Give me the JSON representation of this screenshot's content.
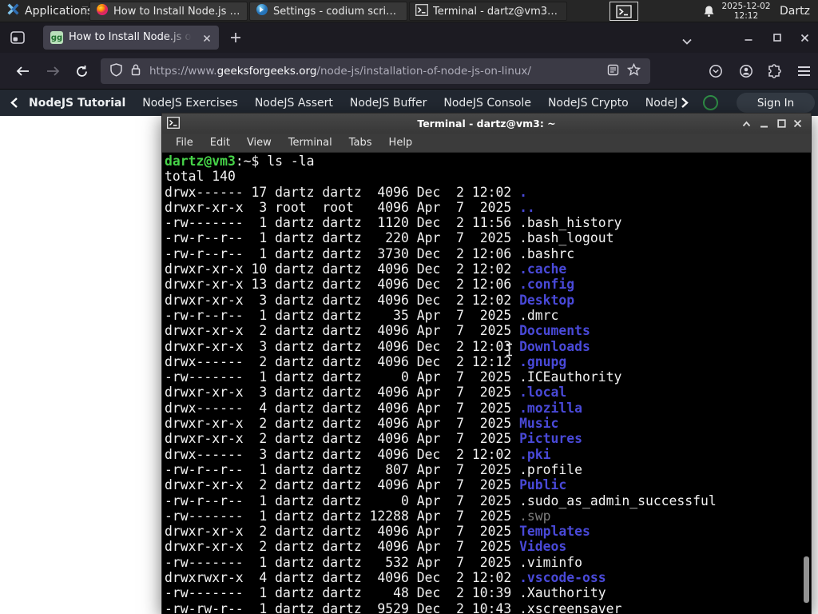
{
  "panel": {
    "applications_label": "Applications",
    "windows": [
      {
        "label": "How to Install Node.js o...",
        "icon": "firefox"
      },
      {
        "label": "Settings - codium script...",
        "icon": "vscodium"
      },
      {
        "label": "Terminal - dartz@vm3: ~",
        "icon": "terminal"
      }
    ],
    "clock_date": "2025-12-02",
    "clock_time": "12:12",
    "user_label": "Dartz"
  },
  "browser": {
    "tab_title": "How to Install Node.js on",
    "favicon_text": "gg",
    "url_prefix": "https://www.",
    "url_domain": "geeksforgeeks.org",
    "url_path": "/node-js/installation-of-node-js-on-linux/"
  },
  "site_nav": {
    "links": [
      "NodeJS Tutorial",
      "NodeJS Exercises",
      "NodeJS Assert",
      "NodeJS Buffer",
      "NodeJS Console",
      "NodeJS Crypto",
      "NodeJS DNS",
      "Node"
    ],
    "sign_in_label": "Sign In"
  },
  "terminal": {
    "window_title": "Terminal - dartz@vm3: ~",
    "menu_items": [
      "File",
      "Edit",
      "View",
      "Terminal",
      "Tabs",
      "Help"
    ],
    "prompt_user": "dartz@vm3",
    "prompt_suffix": ":~$ ",
    "command": "ls -la",
    "total_line": "total 140",
    "listing": [
      {
        "perm": "drwx------",
        "links": "17",
        "owner": "dartz",
        "group": "dartz",
        "size": "4096",
        "date": "Dec  2 12:02",
        "name": ".",
        "type": "dir"
      },
      {
        "perm": "drwxr-xr-x",
        "links": "3",
        "owner": "root",
        "group": "root",
        "size": "4096",
        "date": "Apr  7  2025",
        "name": "..",
        "type": "dir"
      },
      {
        "perm": "-rw-------",
        "links": "1",
        "owner": "dartz",
        "group": "dartz",
        "size": "1120",
        "date": "Dec  2 11:56",
        "name": ".bash_history",
        "type": "file"
      },
      {
        "perm": "-rw-r--r--",
        "links": "1",
        "owner": "dartz",
        "group": "dartz",
        "size": "220",
        "date": "Apr  7  2025",
        "name": ".bash_logout",
        "type": "file"
      },
      {
        "perm": "-rw-r--r--",
        "links": "1",
        "owner": "dartz",
        "group": "dartz",
        "size": "3730",
        "date": "Dec  2 12:06",
        "name": ".bashrc",
        "type": "file"
      },
      {
        "perm": "drwxr-xr-x",
        "links": "10",
        "owner": "dartz",
        "group": "dartz",
        "size": "4096",
        "date": "Dec  2 12:02",
        "name": ".cache",
        "type": "dir"
      },
      {
        "perm": "drwxr-xr-x",
        "links": "13",
        "owner": "dartz",
        "group": "dartz",
        "size": "4096",
        "date": "Dec  2 12:06",
        "name": ".config",
        "type": "dir"
      },
      {
        "perm": "drwxr-xr-x",
        "links": "3",
        "owner": "dartz",
        "group": "dartz",
        "size": "4096",
        "date": "Dec  2 12:02",
        "name": "Desktop",
        "type": "dir"
      },
      {
        "perm": "-rw-r--r--",
        "links": "1",
        "owner": "dartz",
        "group": "dartz",
        "size": "35",
        "date": "Apr  7  2025",
        "name": ".dmrc",
        "type": "file"
      },
      {
        "perm": "drwxr-xr-x",
        "links": "2",
        "owner": "dartz",
        "group": "dartz",
        "size": "4096",
        "date": "Apr  7  2025",
        "name": "Documents",
        "type": "dir"
      },
      {
        "perm": "drwxr-xr-x",
        "links": "3",
        "owner": "dartz",
        "group": "dartz",
        "size": "4096",
        "date": "Dec  2 12:03",
        "name": "Downloads",
        "type": "dir"
      },
      {
        "perm": "drwx------",
        "links": "2",
        "owner": "dartz",
        "group": "dartz",
        "size": "4096",
        "date": "Dec  2 12:12",
        "name": ".gnupg",
        "type": "dir"
      },
      {
        "perm": "-rw-------",
        "links": "1",
        "owner": "dartz",
        "group": "dartz",
        "size": "0",
        "date": "Apr  7  2025",
        "name": ".ICEauthority",
        "type": "file"
      },
      {
        "perm": "drwxr-xr-x",
        "links": "3",
        "owner": "dartz",
        "group": "dartz",
        "size": "4096",
        "date": "Apr  7  2025",
        "name": ".local",
        "type": "dir"
      },
      {
        "perm": "drwx------",
        "links": "4",
        "owner": "dartz",
        "group": "dartz",
        "size": "4096",
        "date": "Apr  7  2025",
        "name": ".mozilla",
        "type": "dir"
      },
      {
        "perm": "drwxr-xr-x",
        "links": "2",
        "owner": "dartz",
        "group": "dartz",
        "size": "4096",
        "date": "Apr  7  2025",
        "name": "Music",
        "type": "dir"
      },
      {
        "perm": "drwxr-xr-x",
        "links": "2",
        "owner": "dartz",
        "group": "dartz",
        "size": "4096",
        "date": "Apr  7  2025",
        "name": "Pictures",
        "type": "dir"
      },
      {
        "perm": "drwx------",
        "links": "3",
        "owner": "dartz",
        "group": "dartz",
        "size": "4096",
        "date": "Dec  2 12:02",
        "name": ".pki",
        "type": "dir"
      },
      {
        "perm": "-rw-r--r--",
        "links": "1",
        "owner": "dartz",
        "group": "dartz",
        "size": "807",
        "date": "Apr  7  2025",
        "name": ".profile",
        "type": "file"
      },
      {
        "perm": "drwxr-xr-x",
        "links": "2",
        "owner": "dartz",
        "group": "dartz",
        "size": "4096",
        "date": "Apr  7  2025",
        "name": "Public",
        "type": "dir"
      },
      {
        "perm": "-rw-r--r--",
        "links": "1",
        "owner": "dartz",
        "group": "dartz",
        "size": "0",
        "date": "Apr  7  2025",
        "name": ".sudo_as_admin_successful",
        "type": "file"
      },
      {
        "perm": "-rw-------",
        "links": "1",
        "owner": "dartz",
        "group": "dartz",
        "size": "12288",
        "date": "Apr  7  2025",
        "name": ".swp",
        "type": "dim"
      },
      {
        "perm": "drwxr-xr-x",
        "links": "2",
        "owner": "dartz",
        "group": "dartz",
        "size": "4096",
        "date": "Apr  7  2025",
        "name": "Templates",
        "type": "dir"
      },
      {
        "perm": "drwxr-xr-x",
        "links": "2",
        "owner": "dartz",
        "group": "dartz",
        "size": "4096",
        "date": "Apr  7  2025",
        "name": "Videos",
        "type": "dir"
      },
      {
        "perm": "-rw-------",
        "links": "1",
        "owner": "dartz",
        "group": "dartz",
        "size": "532",
        "date": "Apr  7  2025",
        "name": ".viminfo",
        "type": "file"
      },
      {
        "perm": "drwxrwxr-x",
        "links": "4",
        "owner": "dartz",
        "group": "dartz",
        "size": "4096",
        "date": "Dec  2 12:02",
        "name": ".vscode-oss",
        "type": "dir"
      },
      {
        "perm": "-rw-------",
        "links": "1",
        "owner": "dartz",
        "group": "dartz",
        "size": "48",
        "date": "Dec  2 10:39",
        "name": ".Xauthority",
        "type": "file"
      },
      {
        "perm": "-rw-rw-r--",
        "links": "1",
        "owner": "dartz",
        "group": "dartz",
        "size": "9529",
        "date": "Dec  2 10:43",
        "name": ".xscreensaver",
        "type": "file"
      }
    ]
  },
  "colors": {
    "prompt_green": "#46d348",
    "dir_blue": "#4949d8",
    "dim_gray": "#7c7c7c",
    "gfg_green": "#2f8d46"
  }
}
